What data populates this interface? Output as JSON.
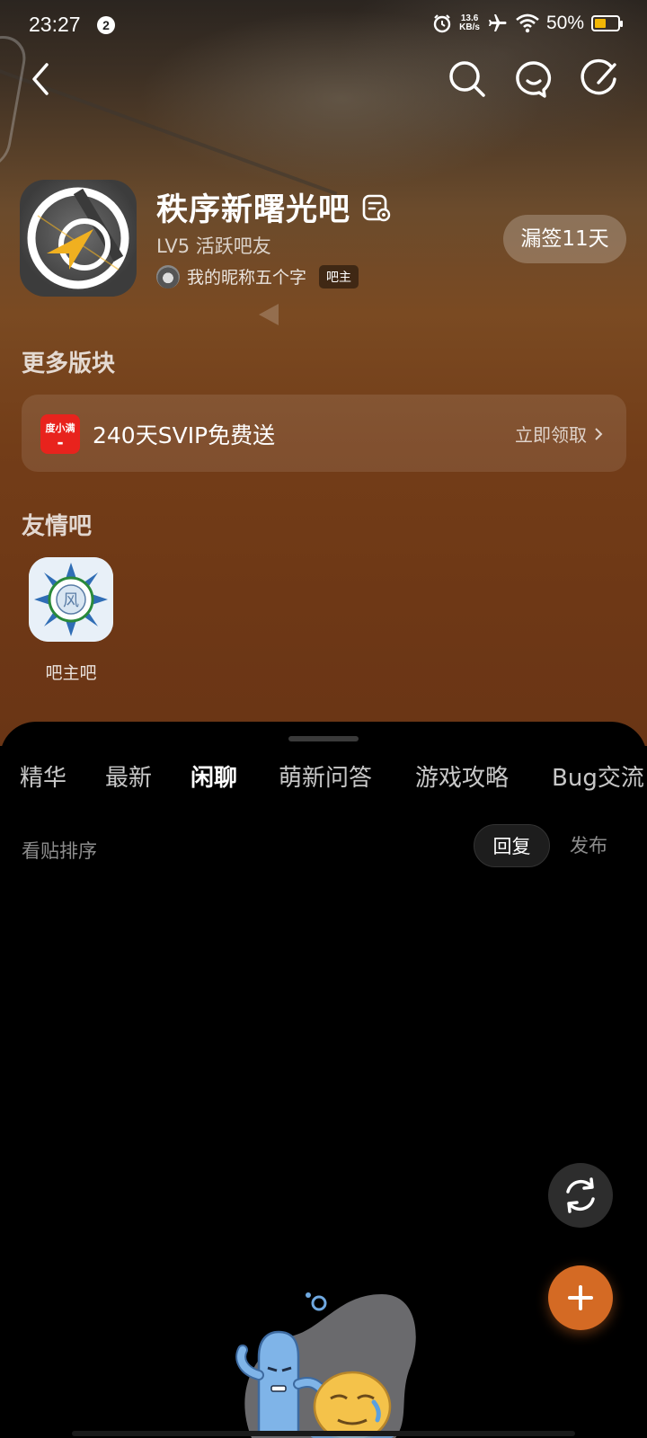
{
  "status_bar": {
    "time": "23:27",
    "notification_count": "2",
    "net_speed_value": "13.6",
    "net_speed_unit": "KB/s",
    "battery_percent": "50%",
    "battery_level": 0.5,
    "icons": [
      "alarm-icon",
      "airplane-icon",
      "wifi-icon",
      "battery-icon"
    ]
  },
  "top_nav": {
    "icons": [
      "back-icon",
      "search-icon",
      "chat-icon",
      "edit-icon"
    ]
  },
  "forum": {
    "name": "秩序新曙光吧",
    "level": "LV5 活跃吧友",
    "owner_name": "我的昵称五个字",
    "owner_badge": "吧主",
    "sign_button": "漏签11天"
  },
  "more_sections": {
    "title": "更多版块",
    "promo": {
      "logo_text": "度小满",
      "text": "240天SVIP免费送",
      "action": "立即领取"
    }
  },
  "friend_bars": {
    "title": "友情吧",
    "items": [
      {
        "name": "吧主吧"
      }
    ]
  },
  "tabs": [
    {
      "label": "精华",
      "active": false
    },
    {
      "label": "最新",
      "active": false
    },
    {
      "label": "闲聊",
      "active": true
    },
    {
      "label": "萌新问答",
      "active": false
    },
    {
      "label": "游戏攻略",
      "active": false
    },
    {
      "label": "Bug交流",
      "active": false
    }
  ],
  "sort": {
    "label": "看贴排序",
    "options": [
      "回复",
      "发布"
    ],
    "selected": "回复"
  },
  "colors": {
    "accent": "#d46a24",
    "battery": "#f2b705",
    "promo_logo": "#e8231d"
  }
}
